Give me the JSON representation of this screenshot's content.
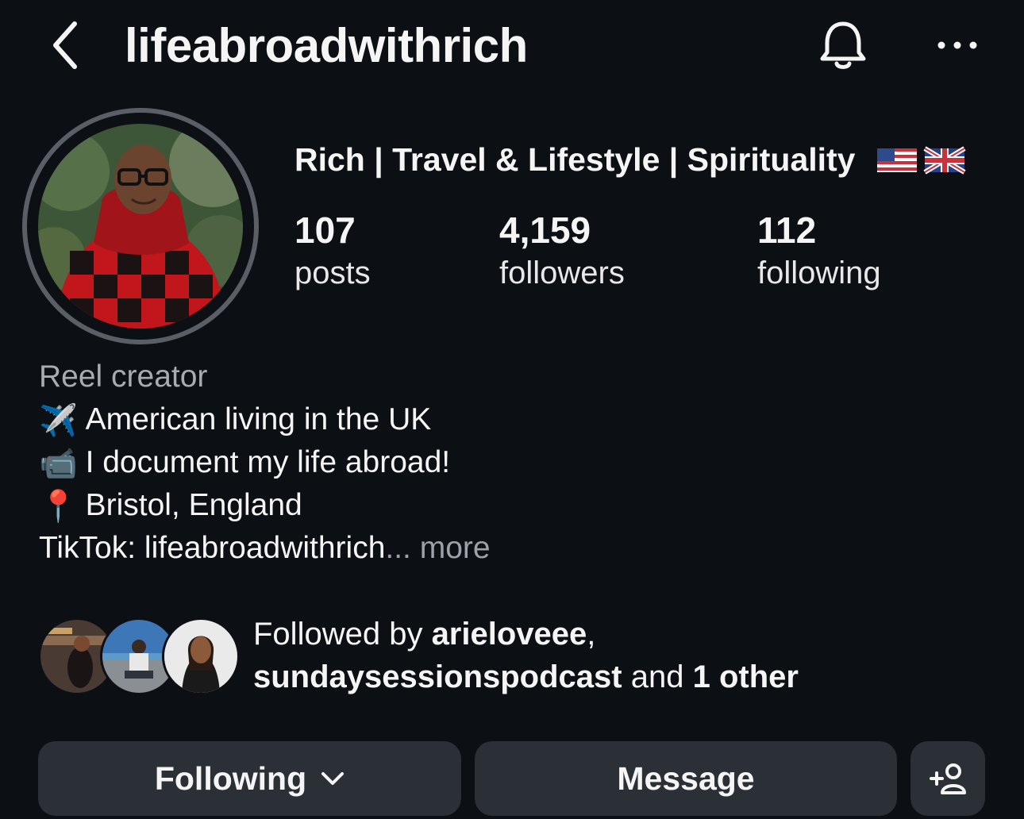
{
  "header": {
    "username": "lifeabroadwithrich",
    "back_icon": "chevron-left-icon",
    "notification_icon": "bell-icon",
    "more_icon": "more-horizontal-icon"
  },
  "profile": {
    "display_name": "Rich | Travel & Lifestyle | Spirituality",
    "flags": [
      "us-flag",
      "uk-flag"
    ],
    "stats": {
      "posts": {
        "count": "107",
        "label": "posts"
      },
      "followers": {
        "count": "4,159",
        "label": "followers"
      },
      "following": {
        "count": "112",
        "label": "following"
      }
    }
  },
  "bio": {
    "category": "Reel creator",
    "line1": {
      "emoji": "✈️",
      "text": "American living in the UK"
    },
    "line2": {
      "emoji": "📹",
      "text": "I document my life abroad!"
    },
    "line3": {
      "emoji": "📍",
      "text": "Bristol, England"
    },
    "line4": {
      "text": "TikTok: lifeabroadwithrich",
      "ellipsis": "...",
      "more": "more"
    }
  },
  "followed_by": {
    "prefix": "Followed by",
    "user1": "arieloveee",
    "sep": ",",
    "user2": "sundaysessionspodcast",
    "and": "and",
    "others": "1 other"
  },
  "actions": {
    "following_label": "Following",
    "message_label": "Message",
    "add_user_icon": "add-user-icon"
  },
  "colors": {
    "background": "#0c0f14",
    "button": "#2b2f36",
    "secondary_text": "#a8abb0"
  }
}
